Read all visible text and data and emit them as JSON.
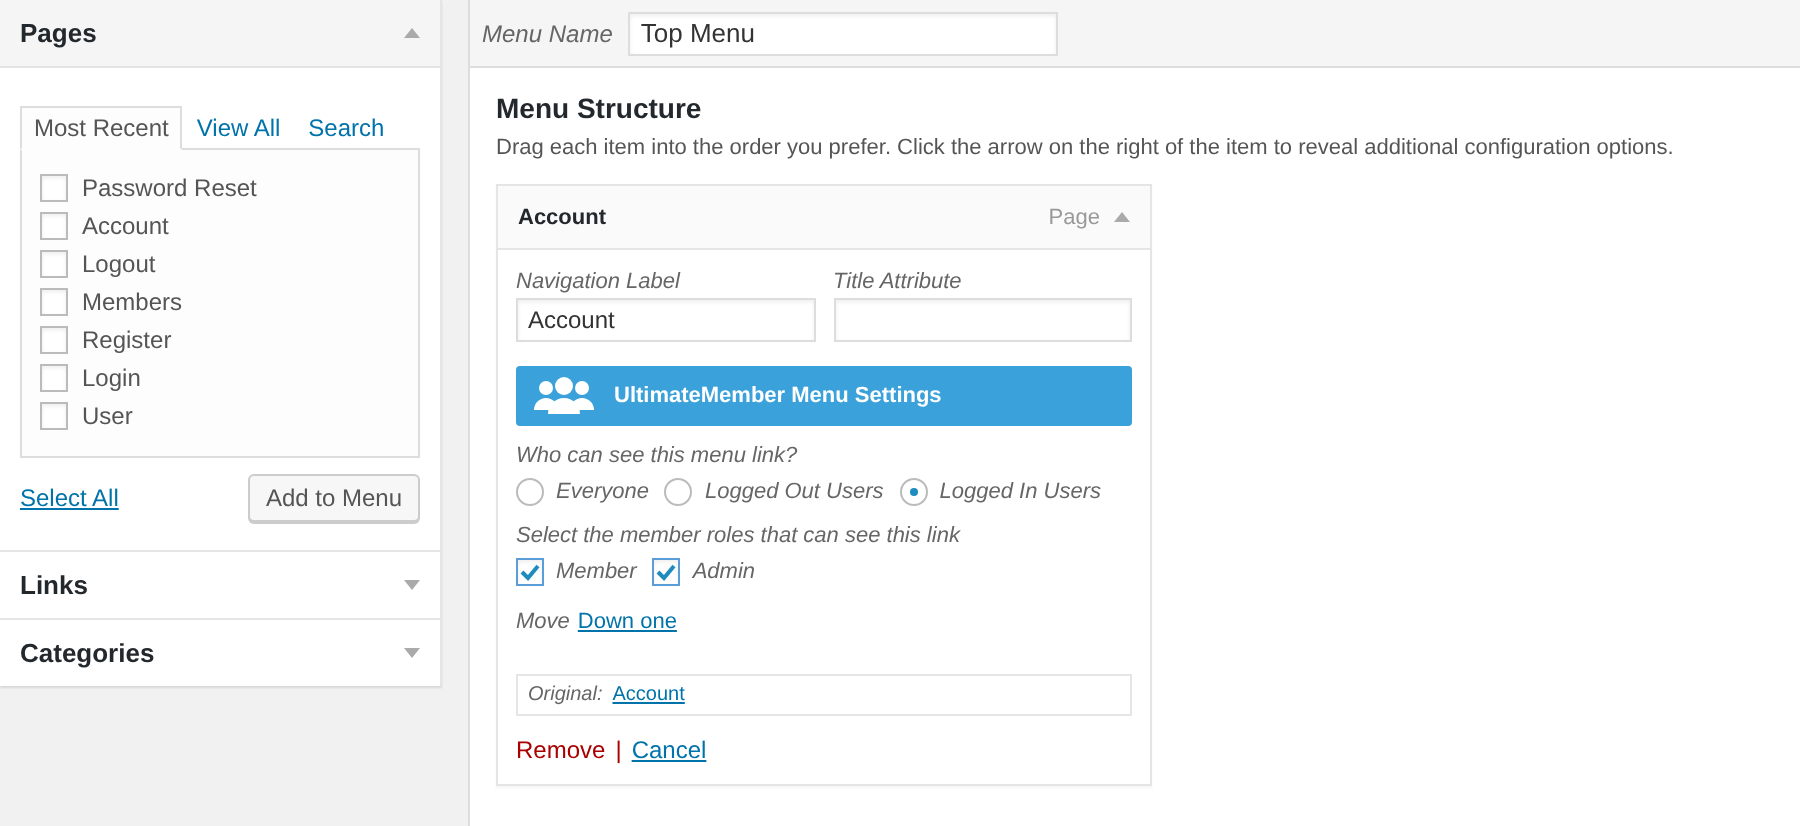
{
  "sidebar": {
    "pages": {
      "title": "Pages",
      "expanded": true,
      "tabs": [
        {
          "label": "Most Recent",
          "selected": true
        },
        {
          "label": "View All",
          "selected": false
        },
        {
          "label": "Search",
          "selected": false
        }
      ],
      "items": [
        {
          "label": "Password Reset",
          "checked": false
        },
        {
          "label": "Account",
          "checked": false
        },
        {
          "label": "Logout",
          "checked": false
        },
        {
          "label": "Members",
          "checked": false
        },
        {
          "label": "Register",
          "checked": false
        },
        {
          "label": "Login",
          "checked": false
        },
        {
          "label": "User",
          "checked": false
        }
      ],
      "select_all": "Select All",
      "add_button": "Add to Menu"
    },
    "sections": [
      {
        "title": "Links",
        "expanded": false
      },
      {
        "title": "Categories",
        "expanded": false
      }
    ]
  },
  "menu_name": {
    "label": "Menu Name",
    "value": "Top Menu"
  },
  "structure": {
    "title": "Menu Structure",
    "description": "Drag each item into the order you prefer. Click the arrow on the right of the item to reveal additional configuration options.",
    "item": {
      "title": "Account",
      "type": "Page",
      "expanded": true,
      "navigation_label": {
        "label": "Navigation Label",
        "value": "Account"
      },
      "title_attribute": {
        "label": "Title Attribute"
      },
      "settings_button": "UltimateMember Menu Settings",
      "visibility": {
        "question": "Who can see this menu link?",
        "options": [
          {
            "label": "Everyone",
            "selected": false
          },
          {
            "label": "Logged Out Users",
            "selected": false
          },
          {
            "label": "Logged In Users",
            "selected": true
          }
        ]
      },
      "roles": {
        "question": "Select the member roles that can see this link",
        "options": [
          {
            "label": "Member",
            "checked": true
          },
          {
            "label": "Admin",
            "checked": true
          }
        ]
      },
      "move": {
        "label": "Move",
        "link": "Down one"
      },
      "original": {
        "label": "Original:",
        "link": "Account"
      },
      "remove": "Remove",
      "separator": "|",
      "cancel": "Cancel"
    }
  }
}
